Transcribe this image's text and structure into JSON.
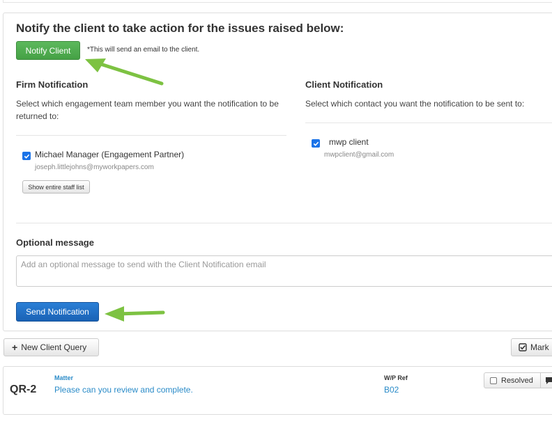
{
  "notify": {
    "heading": "Notify the client to take action for the issues raised below:",
    "button_label": "Notify Client",
    "note": "*This will send an email to the client."
  },
  "firm": {
    "title": "Firm Notification",
    "description": "Select which engagement team member you want the notification to be returned to:",
    "member_name": "Michael Manager (Engagement Partner)",
    "member_email": "joseph.littlejohns@myworkpapers.com",
    "member_checked": true,
    "staff_button": "Show entire staff list"
  },
  "client": {
    "title": "Client Notification",
    "description": "Select which contact you want the notification to be sent to:",
    "contact_name": "mwp client",
    "contact_email": "mwpclient@gmail.com",
    "contact_checked": true
  },
  "message": {
    "label": "Optional message",
    "placeholder": "Add an optional message to send with the Client Notification email"
  },
  "send": {
    "button_label": "Send Notification"
  },
  "toolbar": {
    "new_query_label": "New Client Query",
    "mark_label": "Mark"
  },
  "query": {
    "id": "QR-2",
    "matter_label": "Matter",
    "matter_text": "Please can you review and complete.",
    "wp_ref_label": "W/P Ref",
    "wp_ref_value": "B02",
    "resolved_label": "Resolved"
  },
  "colors": {
    "notify_green": "#5cb85c",
    "send_blue": "#1a62b5",
    "arrow_green": "#7dc242",
    "link_blue": "#2a8bc8"
  },
  "icons": [
    "plus-icon",
    "check-square-icon",
    "arrow-left-icon",
    "comment-icon"
  ]
}
